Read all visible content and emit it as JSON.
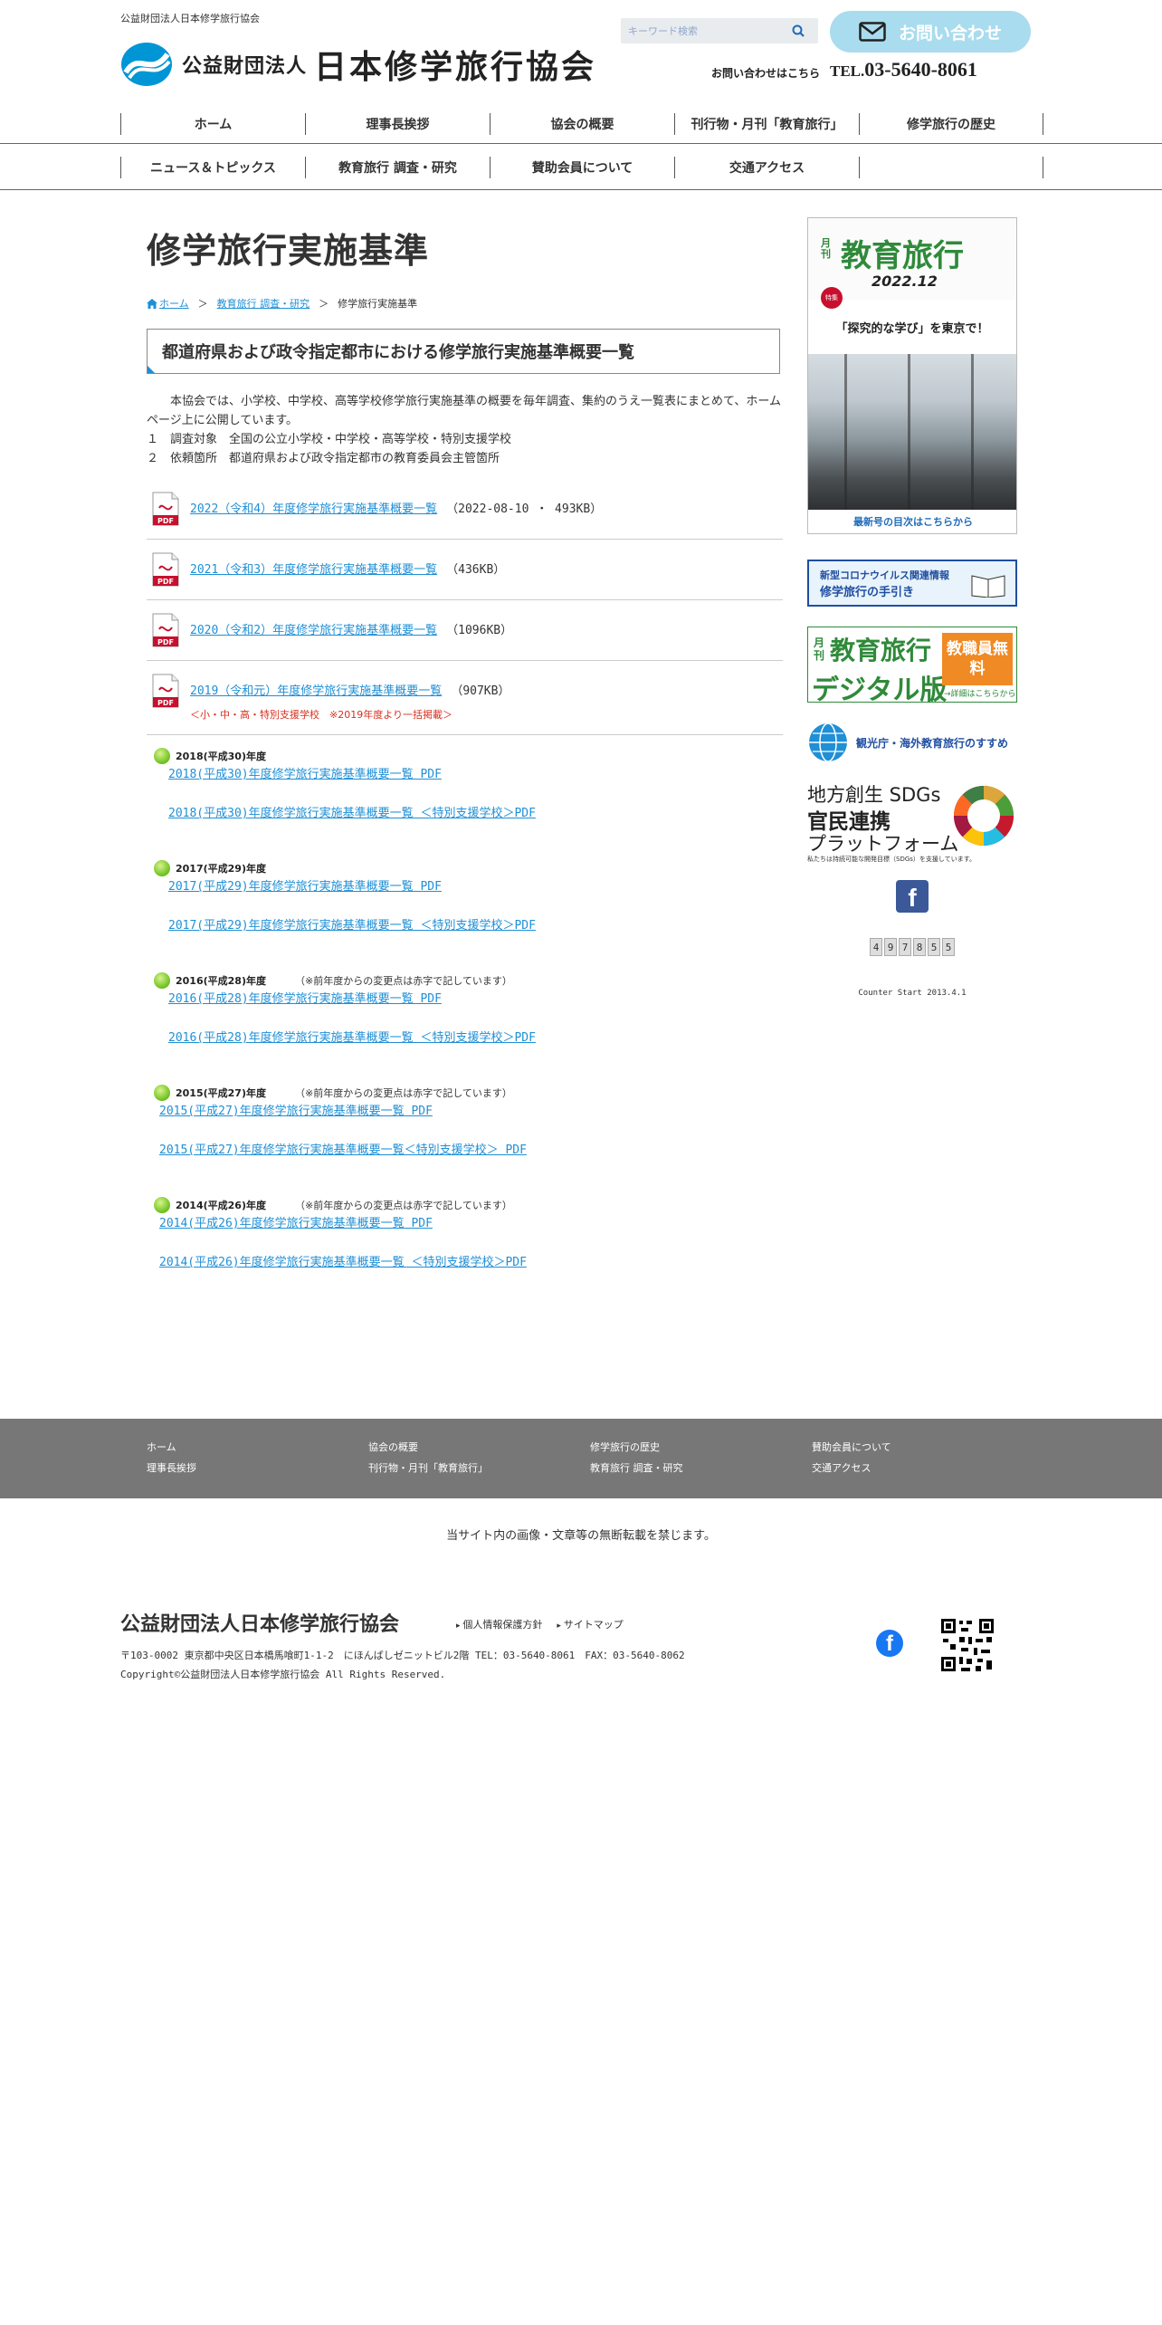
{
  "header": {
    "tagline": "公益財団法人日本修学旅行協会",
    "logo_small": "公益財団法人",
    "logo_big": "日本修学旅行協会",
    "search_placeholder": "キーワード検索",
    "contact_label": "お問い合わせ",
    "contact_note": "お問い合わせはこちら",
    "tel_prefix": "TEL.",
    "tel_number": "03-5640-8061"
  },
  "nav": {
    "row1": [
      "ホーム",
      "理事長挨拶",
      "協会の概要",
      "刊行物・月刊「教育旅行」",
      "修学旅行の歴史"
    ],
    "row2": [
      "ニュース＆トピックス",
      "教育旅行 調査・研究",
      "賛助会員について",
      "交通アクセス",
      ""
    ]
  },
  "main": {
    "title": "修学旅行実施基準",
    "breadcrumb": {
      "home": "ホーム",
      "parent": "教育旅行 調査・研究",
      "current": "修学旅行実施基準",
      "sep": "＞"
    },
    "section_heading": "都道府県および政令指定都市における修学旅行実施基準概要一覧",
    "intro": [
      "本協会では、小学校、中学校、高等学校修学旅行実施基準の概要を毎年調査、集約のうえ一覧表にまとめて、ホームページ上に公開しています。",
      "１　調査対象　全国の公立小学校・中学校・高等学校・特別支援学校",
      "２　依頼箇所　都道府県および政令指定都市の教育委員会主管箇所"
    ],
    "pdf_items": [
      {
        "link": "2022（令和4）年度修学旅行実施基準概要一覧",
        "size": "（2022-08-10 ・ 493KB）",
        "note": ""
      },
      {
        "link": "2021（令和3）年度修学旅行実施基準概要一覧",
        "size": "（436KB）",
        "note": ""
      },
      {
        "link": "2020（令和2）年度修学旅行実施基準概要一覧",
        "size": "（1096KB）",
        "note": ""
      },
      {
        "link": "2019（令和元）年度修学旅行実施基準概要一覧",
        "size": "（907KB）",
        "note": "＜小・中・高・特別支援学校　※2019年度より一括掲載＞"
      }
    ],
    "years": [
      {
        "head": "2018(平成30)年度",
        "remark": "",
        "link1": "2018(平成30)年度修学旅行実施基準概要一覧 PDF ",
        "link2": " 2018(平成30)年度修学旅行実施基準概要一覧 ＜特別支援学校＞PDF "
      },
      {
        "head": "2017(平成29)年度",
        "remark": "",
        "link1": "2017(平成29)年度修学旅行実施基準概要一覧 PDF ",
        "link2": "2017(平成29)年度修学旅行実施基準概要一覧 ＜特別支援学校＞PDF "
      },
      {
        "head": "2016(平成28)年度",
        "remark": "（※前年度からの変更点は赤字で記しています）",
        "link1": "2016(平成28)年度修学旅行実施基準概要一覧 PDF ",
        "link2": "2016(平成28)年度修学旅行実施基準概要一覧 ＜特別支援学校＞PDF "
      },
      {
        "head": "2015(平成27)年度",
        "remark": "（※前年度からの変更点は赤字で記しています）",
        "link1": "2015(平成27)年度修学旅行実施基準概要一覧 PDF ",
        "link2": "2015(平成27)年度修学旅行実施基準概要一覧＜特別支援学校＞ PDF"
      },
      {
        "head": "2014(平成26)年度",
        "remark": "（※前年度からの変更点は赤字で記しています）",
        "link1": "2014(平成26)年度修学旅行実施基準概要一覧 PDF",
        "link2": "2014(平成26)年度修学旅行実施基準概要一覧 ＜特別支援学校＞PDF"
      }
    ]
  },
  "sidebar": {
    "magazine": {
      "getsu": "月刊",
      "title": "教育旅行",
      "date": "2022.12",
      "badge": "特集",
      "feature": "「探究的な学び」を東京で！",
      "caption": "最新号の目次はこちらから"
    },
    "covid": {
      "line1": "新型コロナウイルス関連情報",
      "line2": "修学旅行の手引き"
    },
    "digital": {
      "getsu": "月刊",
      "title": "教育旅行",
      "sub": "デジタル版",
      "box": "教職員無料",
      "more": "→詳細はこちらから"
    },
    "tourism": "観光庁・海外教育旅行のすすめ",
    "sdgs": {
      "l1": "地方創生 SDGs",
      "l2": "官民連携",
      "l3": "プラットフォーム",
      "sub": "私たちは持続可能な開発目標（SDGs）を支援しています。"
    },
    "fb_glyph": "f",
    "counter": [
      "4",
      "9",
      "7",
      "8",
      "5",
      "5"
    ],
    "counter_note": "Counter Start 2013.4.1"
  },
  "footer": {
    "col1": [
      "ホーム",
      "理事長挨拶"
    ],
    "col2": [
      "協会の概要",
      "刊行物・月刊「教育旅行」"
    ],
    "col3": [
      "修学旅行の歴史",
      "教育旅行 調査・研究"
    ],
    "col4": [
      "賛助会員について",
      "交通アクセス"
    ],
    "notice": "当サイト内の画像・文章等の無断転載を禁じます。",
    "org": "公益財団法人日本修学旅行協会",
    "links": [
      "個人情報保護方針",
      "サイトマップ"
    ],
    "address": "〒103-0002 東京都中央区日本橋馬喰町1-1-2　にほんばしゼニットビル2階 TEL：03-5640-8061　FAX：03-5640-8062",
    "copyright": "Copyright©公益財団法人日本修学旅行協会 All Rights Reserved.",
    "fb_glyph": "f"
  },
  "colors": {
    "link": "#1f8fd6",
    "accent_green": "#2f8a3a",
    "contact_button": "#a9dcee",
    "footer_bg": "#777777",
    "note_red": "#d7301f"
  },
  "icons": [
    "search-icon",
    "mail-icon",
    "home-icon",
    "pdf-icon",
    "bullet-dot-icon",
    "facebook-icon",
    "qr-code-icon",
    "globe-icon",
    "book-icon",
    "sdgs-wheel-icon"
  ]
}
